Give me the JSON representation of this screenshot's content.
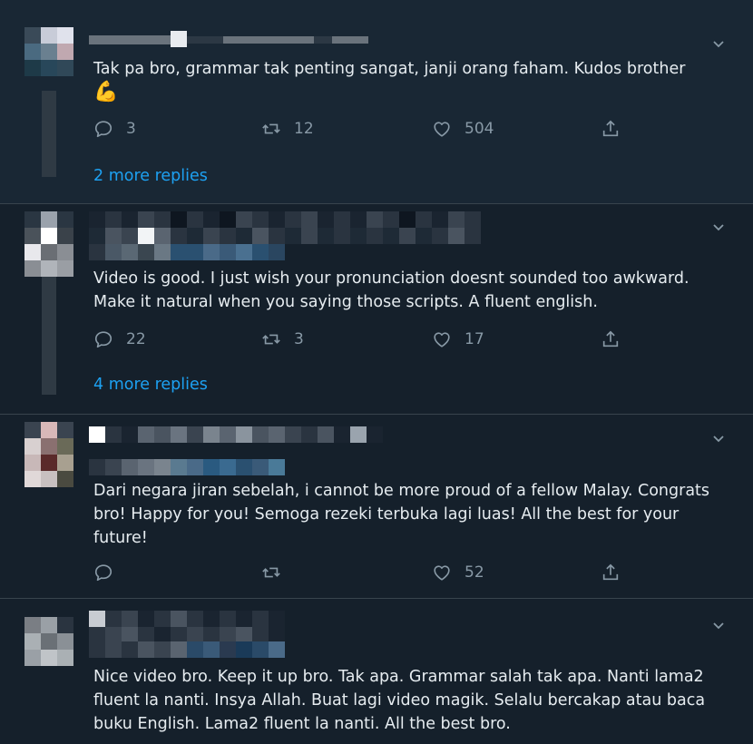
{
  "replies": [
    {
      "text": "Tak pa bro, grammar tak penting sangat, janji orang faham. Kudos brother",
      "emoji": "💪",
      "reply_count": "3",
      "retweet_count": "12",
      "like_count": "504",
      "more_replies": "2 more replies"
    },
    {
      "text": "Video is good. I just wish your pronunciation doesnt sounded too awkward. Make it natural when you saying those scripts. A fluent english.",
      "reply_count": "22",
      "retweet_count": "3",
      "like_count": "17",
      "more_replies": "4 more replies"
    },
    {
      "text": "Dari negara jiran sebelah, i cannot be more proud of a fellow Malay. Congrats bro! Happy for you! Semoga rezeki terbuka lagi luas! All the best for your future!",
      "reply_count": "",
      "retweet_count": "",
      "like_count": "52"
    },
    {
      "text": "Nice video bro. Keep it up bro. Tak apa. Grammar salah tak apa. Nanti lama2 fluent la nanti. Insya Allah. Buat lagi video magik. Selalu bercakap atau baca buku English. Lama2 fluent la nanti. All the best bro."
    }
  ],
  "icons": {
    "reply": "reply-icon",
    "retweet": "retweet-icon",
    "like": "heart-icon",
    "share": "share-icon",
    "menu": "chevron-down-icon"
  },
  "colors": {
    "background": "#15202b",
    "highlight_background": "#192734",
    "text": "#e6ecf0",
    "muted": "#8899a6",
    "link": "#1da1f2",
    "divider": "#38444d"
  }
}
